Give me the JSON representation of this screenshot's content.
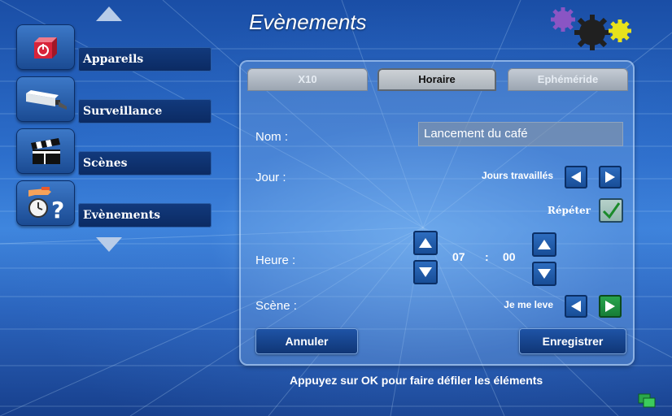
{
  "title": "Evènements",
  "sidebar": {
    "items": [
      {
        "label": "Appareils",
        "icon": "power-box-icon"
      },
      {
        "label": "Surveillance",
        "icon": "camera-icon"
      },
      {
        "label": "Scènes",
        "icon": "clapperboard-icon"
      },
      {
        "label": "Evènements",
        "icon": "hand-clock-question-icon"
      }
    ]
  },
  "tabs": [
    {
      "label": "X10",
      "active": false
    },
    {
      "label": "Horaire",
      "active": true
    },
    {
      "label": "Ephéméride",
      "active": false
    }
  ],
  "form": {
    "name_label": "Nom :",
    "name_value": "Lancement  du café",
    "day_label": "Jour :",
    "day_value": "Jours travaillés",
    "repeat_label": "Répéter",
    "repeat_checked": true,
    "time_label": "Heure :",
    "hour": "07",
    "separator": ":",
    "minute": "00",
    "scene_label": "Scène :",
    "scene_value": "Je me leve"
  },
  "buttons": {
    "cancel": "Annuler",
    "save": "Enregistrer"
  },
  "footer": "Appuyez sur OK pour faire défiler les éléments",
  "colors": {
    "accent_blue": "#1f55a8",
    "green_button": "#2aa850",
    "check_green": "#1a8a2a"
  }
}
